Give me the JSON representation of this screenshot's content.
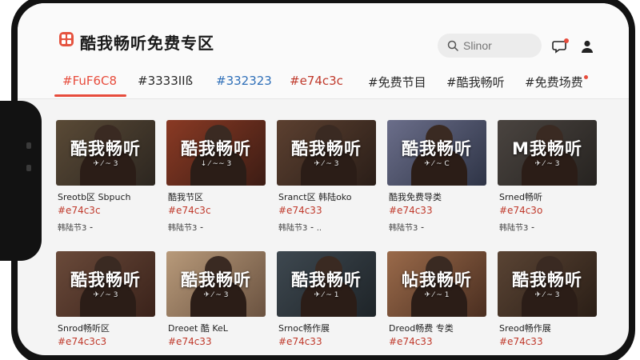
{
  "app": {
    "title": "酷我畅听免费专区",
    "accent": "#e74c3c"
  },
  "search": {
    "placeholder": "Slinor"
  },
  "header_icons": [
    "message-icon",
    "user-icon"
  ],
  "tabs": [
    {
      "label": "#FuF6C8",
      "active": true
    },
    {
      "label": "#3333IIß",
      "active": false
    },
    {
      "label": "#332323",
      "active": false,
      "color": "#2e6fb8"
    },
    {
      "label": "#e74c3c",
      "active": false,
      "color": "#e74c3c"
    },
    {
      "label": "#免费节目",
      "active": false
    },
    {
      "label": "#酷我畅听",
      "active": false
    },
    {
      "label": "#免费场费",
      "active": false,
      "dot": true
    }
  ],
  "cards": [
    {
      "thumb_title": "酷我畅听",
      "thumb_sub": "✈ ⁄ ~ 3",
      "name": "Sreotb区  Sbpuch",
      "price": "#e74c3c",
      "meta": "韩陆节3 ⁃",
      "colors": [
        "#5a4a36",
        "#2c2620"
      ]
    },
    {
      "thumb_title": "酷我畅听",
      "thumb_sub": "↓ ⁄ ∼∼ 3",
      "name": "酷我节区",
      "price": "#e74c3c",
      "meta": "韩陆节3 ⁃",
      "colors": [
        "#8a3a24",
        "#3c1c14"
      ]
    },
    {
      "thumb_title": "酷我畅听",
      "thumb_sub": "✈ ⁄ ~ 3",
      "name": "Sranct区  韩陆oko",
      "price": "#e74c33",
      "meta": "韩陆节3 ⁃ ..",
      "colors": [
        "#5c4030",
        "#2a1e18"
      ]
    },
    {
      "thumb_title": "酷我畅听",
      "thumb_sub": "✈ ⁄ ~ C",
      "name": "酷我免费导类",
      "price": "#e74c33",
      "meta": "韩陆节3 ⁃",
      "colors": [
        "#6b6e8a",
        "#2e3446"
      ]
    },
    {
      "thumb_title": "M我畅听",
      "thumb_sub": "✈ ⁄ ~ 3",
      "name": "Srned畅听",
      "price": "#e74c3o",
      "meta": "韩陆节3 ⁃",
      "colors": [
        "#4a4440",
        "#262320"
      ]
    },
    {
      "thumb_title": "酷我畅听",
      "thumb_sub": "✈ ⁄ ~ 3",
      "name": "Snrod畅听区",
      "price": "#e74c3c3",
      "meta": "",
      "colors": [
        "#6a4a3a",
        "#3a221a"
      ]
    },
    {
      "thumb_title": "酷我畅听",
      "thumb_sub": "✈ ⁄ ~ 3",
      "name": "Dreoet  酷 KeL",
      "price": "#e74c33",
      "meta": "",
      "colors": [
        "#b89a7a",
        "#6a5240"
      ]
    },
    {
      "thumb_title": "酷我畅听",
      "thumb_sub": "✈ ⁄ ~ 1",
      "name": "Srnoc畅作展",
      "price": "#e74c33",
      "meta": "",
      "colors": [
        "#3e4850",
        "#1e2428"
      ]
    },
    {
      "thumb_title": "帖我畅听",
      "thumb_sub": "✈ ⁄ ~ 1",
      "name": "Dreod畅费 专类",
      "price": "#e74c33",
      "meta": "",
      "colors": [
        "#9a6a4a",
        "#4a2e20"
      ]
    },
    {
      "thumb_title": "酷我畅听",
      "thumb_sub": "✈ ⁄ ~ 3",
      "name": "Sreod畅作展",
      "price": "#e74c33",
      "meta": "",
      "colors": [
        "#5a4434",
        "#2a1e16"
      ]
    }
  ]
}
